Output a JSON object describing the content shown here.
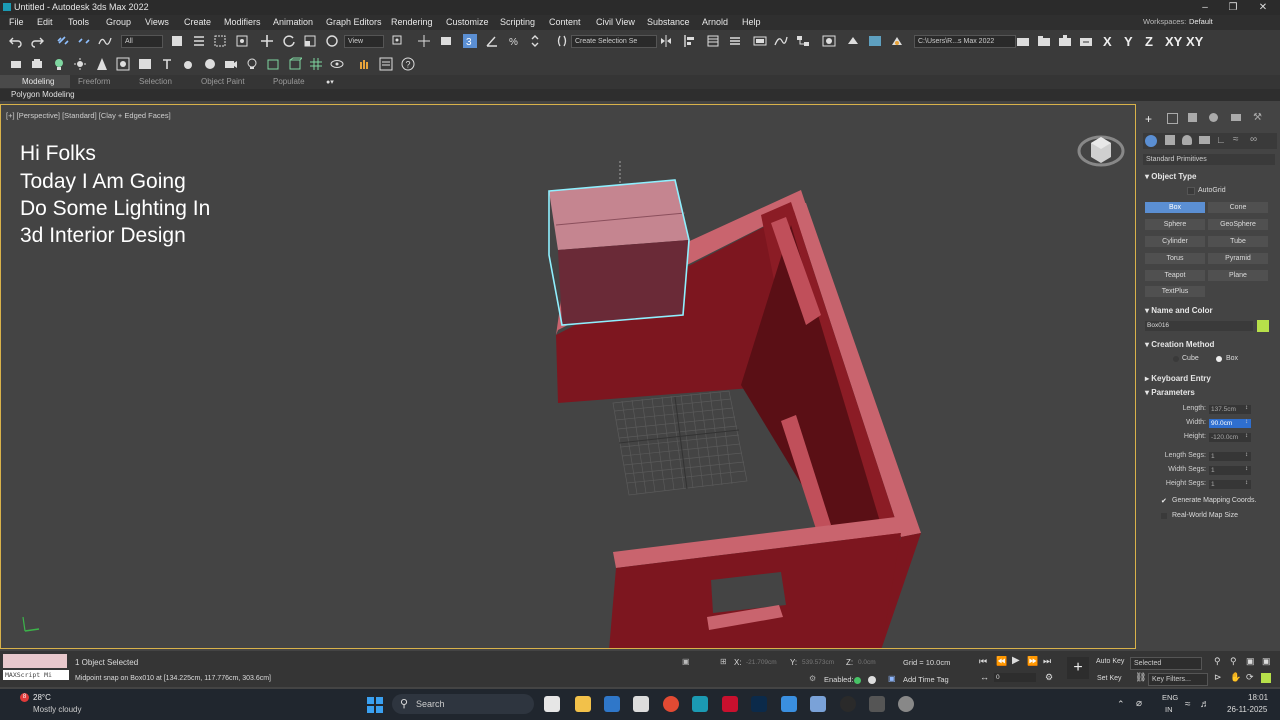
{
  "window": {
    "title": "Untitled - Autodesk 3ds Max 2022",
    "workspaces_label": "Workspaces:",
    "workspace_value": "Default"
  },
  "menu": [
    "File",
    "Edit",
    "Tools",
    "Group",
    "Views",
    "Create",
    "Modifiers",
    "Animation",
    "Graph Editors",
    "Rendering",
    "Customize",
    "Scripting",
    "Content",
    "Civil View",
    "Substance",
    "Arnold",
    "Help"
  ],
  "toolbar": {
    "filter_value": "All",
    "view_value": "View",
    "selection_set_value": "Create Selection Se",
    "path_value": "C:\\Users\\R...s Max 2022",
    "axes": [
      "X",
      "Y",
      "Z",
      "XY",
      "XY"
    ]
  },
  "ribbon": {
    "tabs": [
      "Modeling",
      "Freeform",
      "Selection",
      "Object Paint",
      "Populate"
    ],
    "sub": "Polygon Modeling"
  },
  "viewport": {
    "label": "[+] [Perspective] [Standard] [Clay + Edged Faces]",
    "overlay_lines": [
      "Hi Folks",
      "Today I Am Going",
      "Do Some Lighting In",
      "3d Interior Design"
    ]
  },
  "command_panel": {
    "category_value": "Standard Primitives",
    "object_type_title": "Object Type",
    "autogrid_label": "AutoGrid",
    "primitives": [
      "Box",
      "Cone",
      "Sphere",
      "GeoSphere",
      "Cylinder",
      "Tube",
      "Torus",
      "Pyramid",
      "Teapot",
      "Plane",
      "TextPlus"
    ],
    "active_primitive": "Box",
    "name_color_title": "Name and Color",
    "object_name": "Box016",
    "object_color": "#b7e04a",
    "creation_method_title": "Creation Method",
    "creation_options": [
      "Cube",
      "Box"
    ],
    "keyboard_entry_title": "Keyboard Entry",
    "parameters_title": "Parameters",
    "params": [
      {
        "label": "Length:",
        "value": "137.5cm"
      },
      {
        "label": "Width:",
        "value": "90.0cm"
      },
      {
        "label": "Height:",
        "value": "-120.0cm"
      },
      {
        "label": "Length Segs:",
        "value": "1"
      },
      {
        "label": "Width Segs:",
        "value": "1"
      },
      {
        "label": "Height Segs:",
        "value": "1"
      }
    ],
    "gen_mapping_label": "Generate Mapping Coords.",
    "real_world_label": "Real-World Map Size"
  },
  "status": {
    "maxscript_label": "MAXScript Mi",
    "selected": "1 Object Selected",
    "prompt": "Midpoint snap on Box010 at [134.225cm, 117.776cm, 303.6cm]",
    "x_label": "X:",
    "x_value": "-21.709cm",
    "y_label": "Y:",
    "y_value": "539.573cm",
    "z_label": "Z:",
    "z_value": "0.0cm",
    "grid": "Grid = 10.0cm",
    "enabled_label": "Enabled:",
    "add_time_tag": "Add Time Tag",
    "frame": "0",
    "auto_key": "Auto Key",
    "set_key": "Set Key",
    "selected_dropdown": "Selected",
    "key_filters": "Key Filters..."
  },
  "taskbar": {
    "weather_temp": "28°C",
    "weather_desc": "Mostly cloudy",
    "weather_badge": "8",
    "search_label": "Search",
    "lang_top": "ENG",
    "lang_bottom": "IN",
    "time": "18:01",
    "date": "26-11-2025"
  }
}
